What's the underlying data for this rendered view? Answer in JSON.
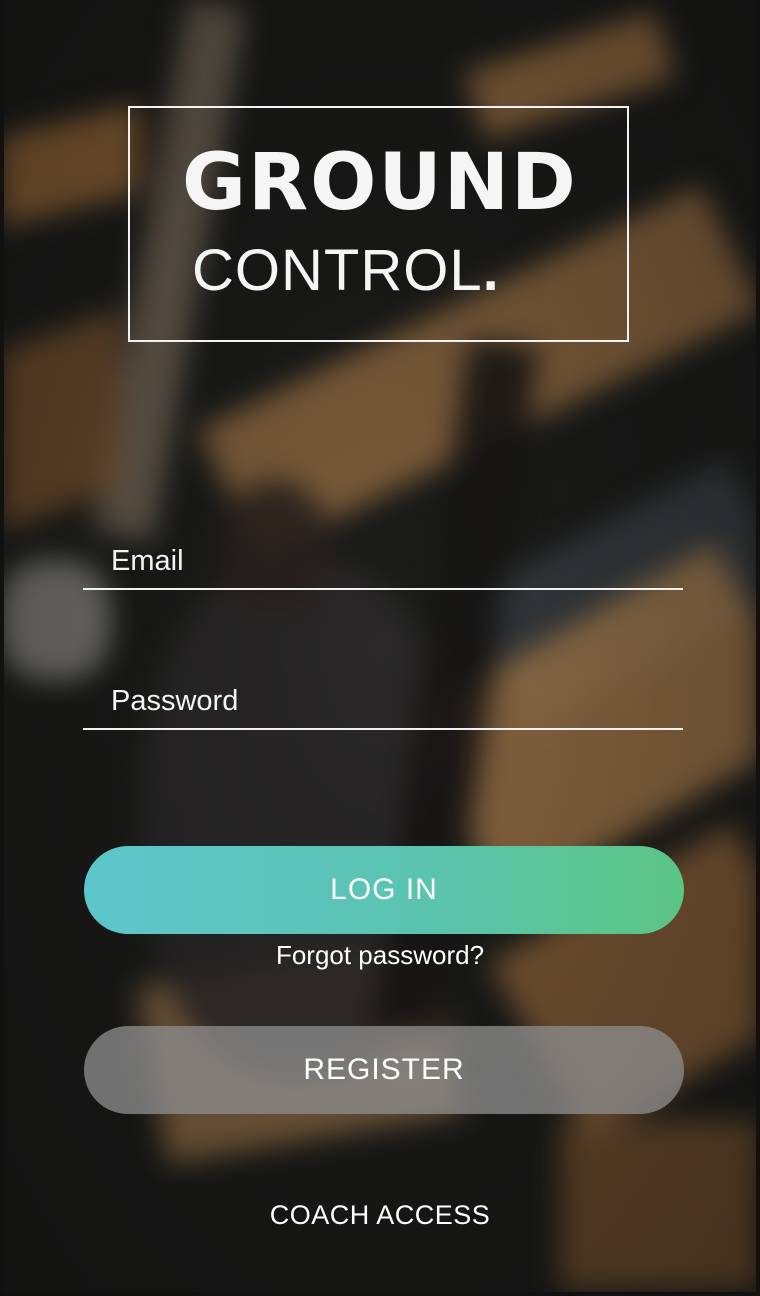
{
  "logo": {
    "line1": "GROUND",
    "line2": "CONTROL",
    "line2_dot": "."
  },
  "form": {
    "email_placeholder": "Email",
    "password_placeholder": "Password"
  },
  "buttons": {
    "login_label": "LOG IN",
    "forgot_label": "Forgot password?",
    "register_label": "REGISTER",
    "coach_label": "COACH ACCESS"
  },
  "colors": {
    "login_gradient_start": "#5cc6cc",
    "login_gradient_end": "#5bc585",
    "register_bg": "#8c8c8c",
    "text": "#ffffff"
  }
}
